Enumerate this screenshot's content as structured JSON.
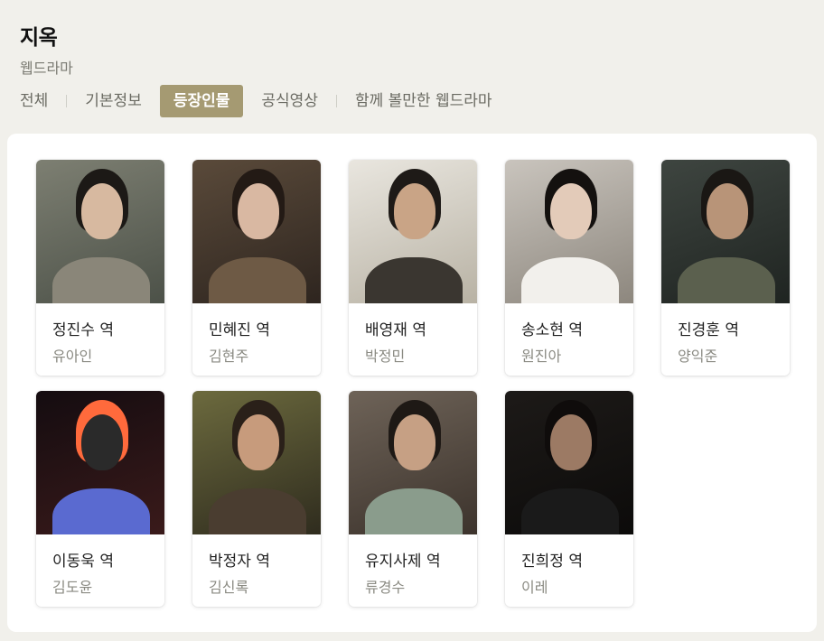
{
  "header": {
    "title": "지옥",
    "subtitle": "웹드라마"
  },
  "tabs": [
    {
      "label": "전체",
      "active": false
    },
    {
      "label": "기본정보",
      "active": false
    },
    {
      "label": "등장인물",
      "active": true
    },
    {
      "label": "공식영상",
      "active": false
    },
    {
      "label": "함께 볼만한 웹드라마",
      "active": false
    }
  ],
  "cast": [
    {
      "role": "정진수 역",
      "actor": "유아인",
      "photo": {
        "bg": "#7d7f72",
        "bg2": "#4c5148",
        "skin": "#d7b9a0",
        "hair": "#1c1916",
        "body": "#8a8679"
      }
    },
    {
      "role": "민혜진 역",
      "actor": "김현주",
      "photo": {
        "bg": "#5a4a3a",
        "bg2": "#2e251f",
        "skin": "#d9b8a2",
        "hair": "#231a15",
        "body": "#6e5a45"
      }
    },
    {
      "role": "배영재 역",
      "actor": "박정민",
      "photo": {
        "bg": "#e9e6df",
        "bg2": "#b8b2a4",
        "skin": "#c9a486",
        "hair": "#1e1a17",
        "body": "#3a3630"
      }
    },
    {
      "role": "송소현 역",
      "actor": "원진아",
      "photo": {
        "bg": "#c9c4bd",
        "bg2": "#8d877e",
        "skin": "#e3cbb9",
        "hair": "#14110f",
        "body": "#f2f0ec"
      }
    },
    {
      "role": "진경훈 역",
      "actor": "양익준",
      "photo": {
        "bg": "#3e4540",
        "bg2": "#1f2421",
        "skin": "#b89478",
        "hair": "#1a1714",
        "body": "#5b604e"
      }
    },
    {
      "role": "이동욱 역",
      "actor": "김도윤",
      "photo": {
        "bg": "#140c10",
        "bg2": "#3a1a1a",
        "skin": "#2a2a2a",
        "hair": "#ff6a3c",
        "body": "#5a6ad0"
      }
    },
    {
      "role": "박정자 역",
      "actor": "김신록",
      "photo": {
        "bg": "#6c6a3e",
        "bg2": "#2f2c1e",
        "skin": "#c79b7c",
        "hair": "#2a2019",
        "body": "#4a3d30"
      }
    },
    {
      "role": "유지사제 역",
      "actor": "류경수",
      "photo": {
        "bg": "#6e6358",
        "bg2": "#3c332c",
        "skin": "#c6a084",
        "hair": "#1e1915",
        "body": "#8a9c8c"
      }
    },
    {
      "role": "진희정 역",
      "actor": "이레",
      "photo": {
        "bg": "#1d1a18",
        "bg2": "#0c0b0a",
        "skin": "#9c7a64",
        "hair": "#0f0c0b",
        "body": "#1a1a1a"
      }
    }
  ]
}
